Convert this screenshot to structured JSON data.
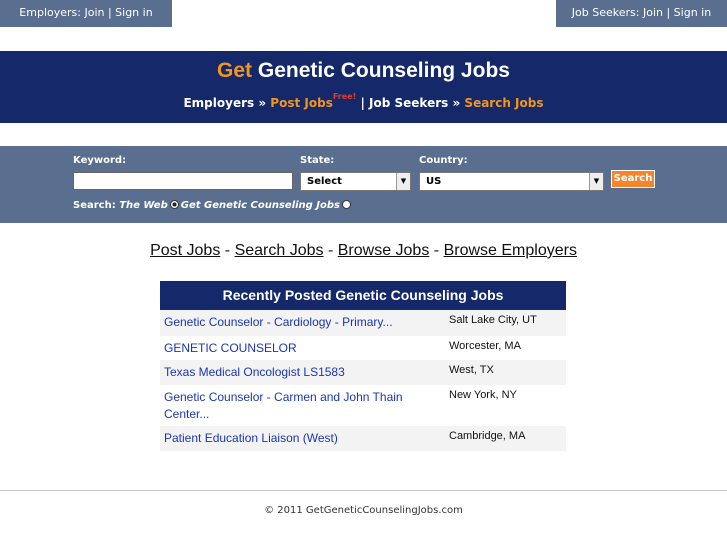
{
  "top": {
    "employers_link": "Employers: Join | Sign in",
    "seekers_link": "Job Seekers: Join | Sign in"
  },
  "header": {
    "title_accent": "Get",
    "title_rest": "Genetic Counseling Jobs",
    "nav": {
      "employers": "Employers",
      "sep1": "»",
      "post_jobs": "Post Jobs",
      "free": "Free!",
      "pipe": "|",
      "job_seekers": "Job Seekers",
      "sep2": "»",
      "search_jobs": "Search Jobs"
    }
  },
  "search": {
    "keyword_label": "Keyword:",
    "keyword_value": "",
    "state_label": "State:",
    "state_value": "Select",
    "country_label": "Country:",
    "country_value": "US",
    "button": "Search",
    "scope_label": "Search:",
    "scope_web": "The Web",
    "scope_site": "Get Genetic Counseling Jobs"
  },
  "links": {
    "post_jobs": "Post Jobs",
    "search_jobs": "Search Jobs",
    "browse_jobs": "Browse Jobs",
    "browse_employers": "Browse Employers",
    "sep": "-"
  },
  "recent": {
    "heading": "Recently Posted Genetic Counseling Jobs",
    "jobs": [
      {
        "title": "Genetic Counselor - Cardiology - Primary...",
        "location": "Salt Lake City, UT"
      },
      {
        "title": "GENETIC COUNSELOR",
        "location": "Worcester, MA"
      },
      {
        "title": "Texas Medical Oncologist LS1583",
        "location": "West, TX"
      },
      {
        "title": "Genetic Counselor - Carmen and John Thain Center...",
        "location": "New York, NY"
      },
      {
        "title": "Patient Education Liaison (West)",
        "location": "Cambridge, MA"
      }
    ]
  },
  "footer": {
    "copyright": "© 2011 GetGeneticCounselingJobs.com"
  }
}
